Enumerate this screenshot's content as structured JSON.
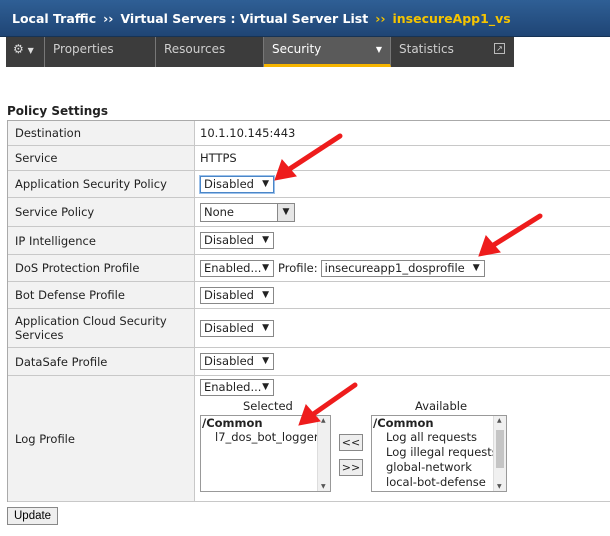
{
  "breadcrumb": {
    "items": [
      "Local Traffic",
      "Virtual Servers : Virtual Server List"
    ],
    "current": "insecureApp1_vs",
    "separator": "››"
  },
  "tabs": [
    {
      "label": "Properties",
      "active": false
    },
    {
      "label": "Resources",
      "active": false
    },
    {
      "label": "Security",
      "active": true
    },
    {
      "label": "Statistics",
      "active": false
    }
  ],
  "section_title": "Policy Settings",
  "rows": {
    "destination": {
      "label": "Destination",
      "value": "10.1.10.145:443"
    },
    "service": {
      "label": "Service",
      "value": "HTTPS"
    },
    "asp": {
      "label": "Application Security Policy",
      "value": "Disabled"
    },
    "service_policy": {
      "label": "Service Policy",
      "value": "None"
    },
    "ip_intel": {
      "label": "IP Intelligence",
      "value": "Disabled"
    },
    "dos": {
      "label": "DoS Protection Profile",
      "value": "Enabled...",
      "profile_label": "Profile:",
      "profile_value": "insecureapp1_dosprofile"
    },
    "bot": {
      "label": "Bot Defense Profile",
      "value": "Disabled"
    },
    "cloud": {
      "label": "Application Cloud Security Services",
      "value": "Disabled"
    },
    "datasafe": {
      "label": "DataSafe Profile",
      "value": "Disabled"
    },
    "log": {
      "label": "Log Profile",
      "value": "Enabled...",
      "selected_header": "Selected",
      "available_header": "Available",
      "selected_group": "/Common",
      "selected_items": [
        "l7_dos_bot_logger"
      ],
      "available_group": "/Common",
      "available_items": [
        "Log all requests",
        "Log illegal requests",
        "global-network",
        "local-bot-defense"
      ],
      "move_left": "<<",
      "move_right": ">>"
    }
  },
  "update_label": "Update",
  "colors": {
    "header_bg": "#2a5689",
    "current_crumb": "#f5c400",
    "tab_bar": "#3c3c3c",
    "active_tab_underline": "#f5b400",
    "annotation_arrow": "#ee1c1c"
  }
}
